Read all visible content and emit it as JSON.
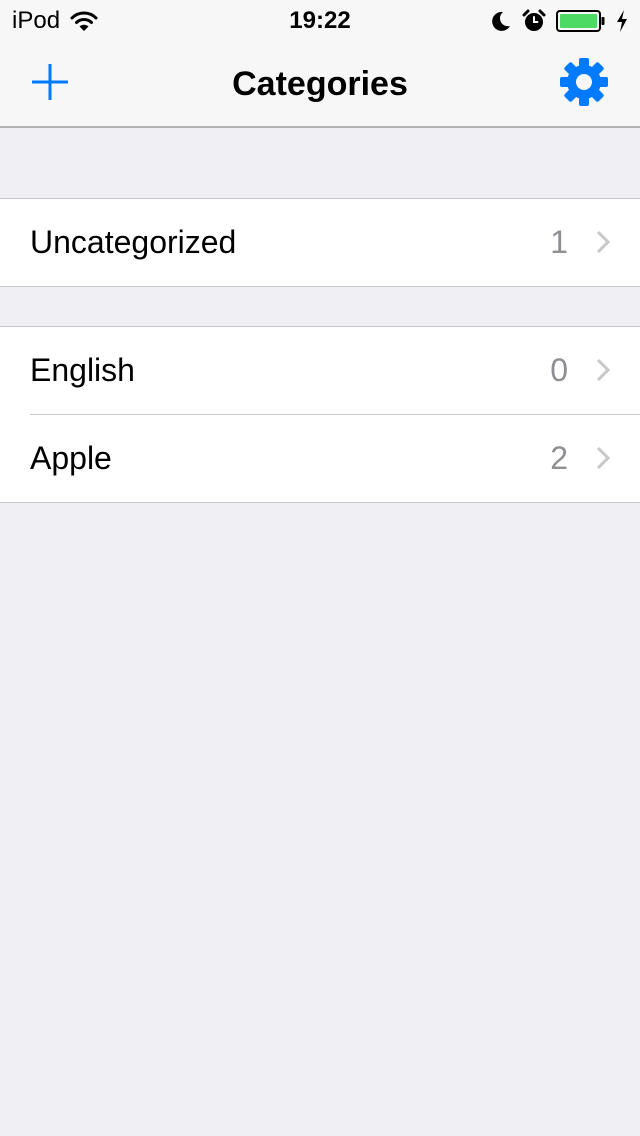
{
  "status_bar": {
    "carrier": "iPod",
    "time": "19:22",
    "icons": [
      "wifi-icon",
      "moon-icon",
      "alarm-icon",
      "battery-icon",
      "charging-icon"
    ],
    "battery_color": "#4cd964"
  },
  "navbar": {
    "title": "Categories",
    "left_icon": "plus-icon",
    "right_icon": "gear-icon",
    "accent_color": "#007aff"
  },
  "sections": [
    {
      "rows": [
        {
          "label": "Uncategorized",
          "count": "1"
        }
      ]
    },
    {
      "rows": [
        {
          "label": "English",
          "count": "0"
        },
        {
          "label": "Apple",
          "count": "2"
        }
      ]
    }
  ]
}
